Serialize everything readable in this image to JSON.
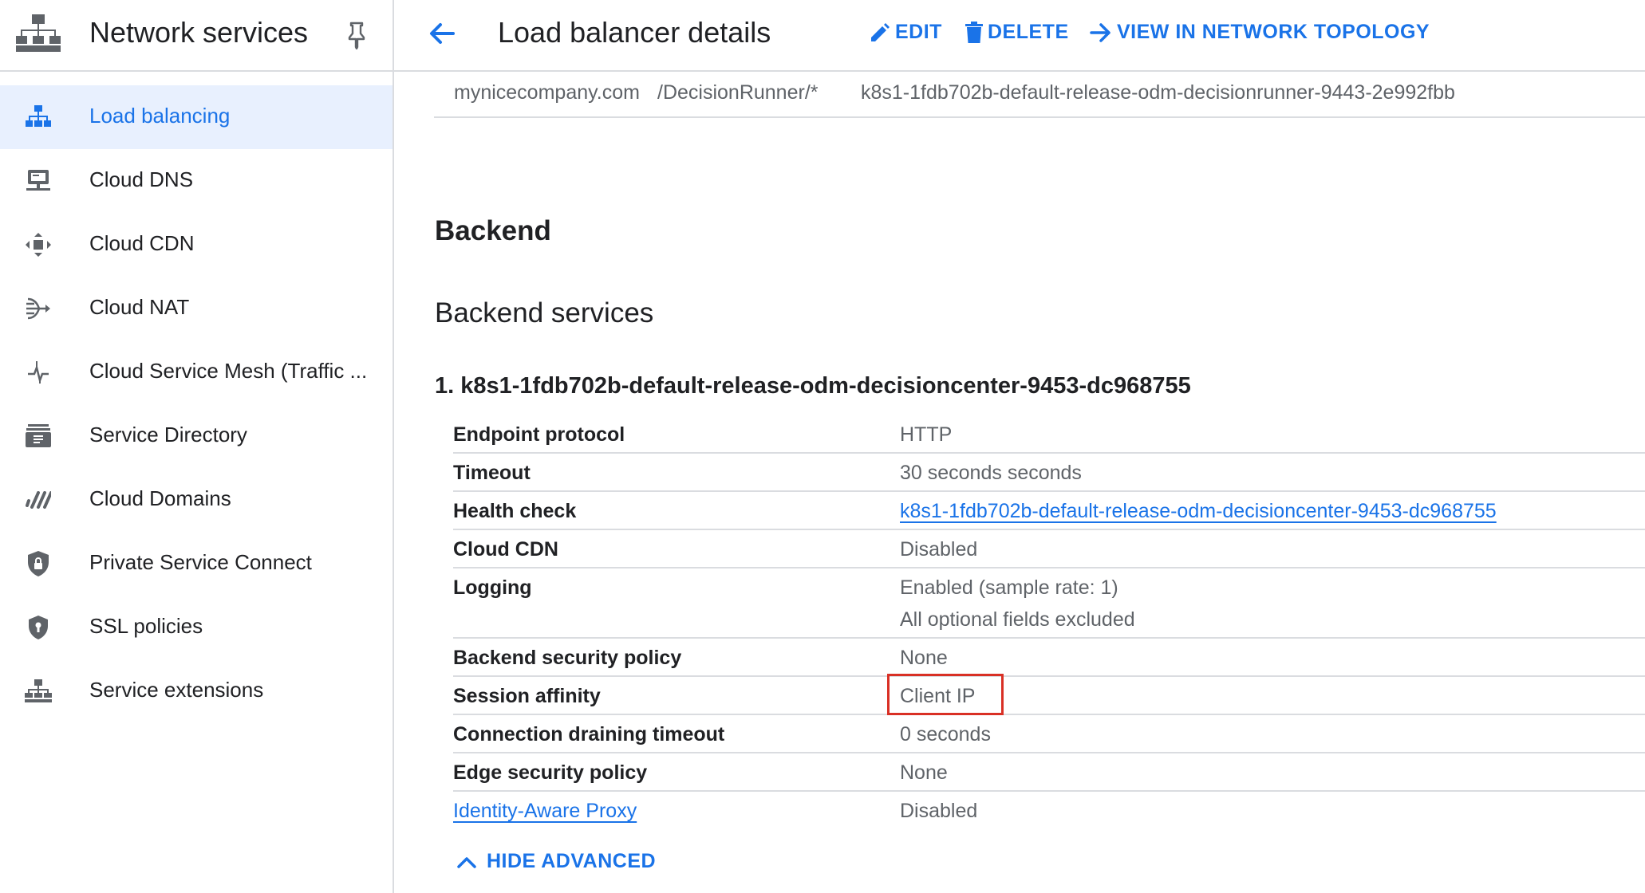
{
  "sidebar": {
    "title": "Network services",
    "items": [
      {
        "label": "Load balancing",
        "icon": "load-balancing-icon",
        "active": true
      },
      {
        "label": "Cloud DNS",
        "icon": "dns-icon"
      },
      {
        "label": "Cloud CDN",
        "icon": "cdn-icon"
      },
      {
        "label": "Cloud NAT",
        "icon": "nat-icon"
      },
      {
        "label": "Cloud Service Mesh (Traffic ...",
        "icon": "service-mesh-icon"
      },
      {
        "label": "Service Directory",
        "icon": "service-directory-icon"
      },
      {
        "label": "Cloud Domains",
        "icon": "domains-icon"
      },
      {
        "label": "Private Service Connect",
        "icon": "private-service-connect-icon"
      },
      {
        "label": "SSL policies",
        "icon": "ssl-policies-icon"
      },
      {
        "label": "Service extensions",
        "icon": "service-extensions-icon"
      }
    ]
  },
  "header": {
    "title": "Load balancer details",
    "actions": {
      "edit": "EDIT",
      "delete": "DELETE",
      "topology": "VIEW IN NETWORK TOPOLOGY"
    }
  },
  "frontend_rule": {
    "host": "mynicecompany.com",
    "path": "/DecisionRunner/*",
    "backend": "k8s1-1fdb702b-default-release-odm-decisionrunner-9443-2e992fbb"
  },
  "backend": {
    "heading": "Backend",
    "subheading": "Backend services",
    "service_title": "1. k8s1-1fdb702b-default-release-odm-decisioncenter-9453-dc968755",
    "properties": [
      {
        "key": "Endpoint protocol",
        "value": "HTTP"
      },
      {
        "key": "Timeout",
        "value": "30 seconds seconds"
      },
      {
        "key": "Health check",
        "value": "k8s1-1fdb702b-default-release-odm-decisioncenter-9453-dc968755"
      },
      {
        "key": "Cloud CDN",
        "value": "Disabled"
      },
      {
        "key": "Logging",
        "value": "Enabled (sample rate: 1)",
        "value2": "All optional fields excluded"
      },
      {
        "key": "Backend security policy",
        "value": "None"
      },
      {
        "key": "Session affinity",
        "value": "Client IP"
      },
      {
        "key": "Connection draining timeout",
        "value": "0 seconds"
      },
      {
        "key": "Edge security policy",
        "value": "None"
      },
      {
        "key": "Identity-Aware Proxy",
        "value": "Disabled"
      }
    ],
    "hide_advanced": "HIDE ADVANCED"
  },
  "colors": {
    "accent": "#1a73e8",
    "active_bg": "#e8f0fe",
    "highlight": "#d93025",
    "divider": "#dadce0"
  }
}
